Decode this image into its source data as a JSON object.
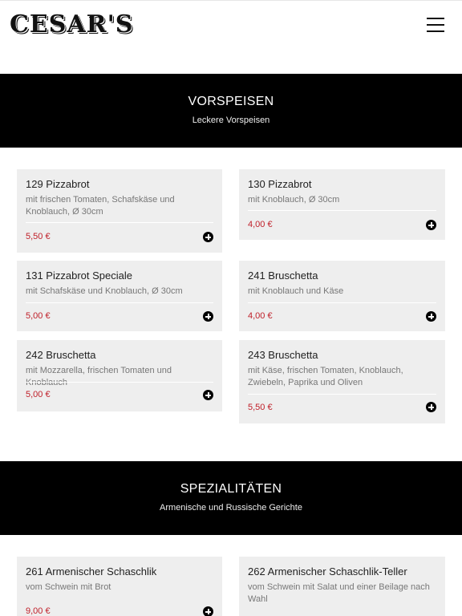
{
  "site": {
    "logo": "CESAR'S"
  },
  "nav": {
    "menu_icon": "hamburger-icon"
  },
  "categories": [
    {
      "title": "VORSPEISEN",
      "subtitle": "Leckere Vorspeisen",
      "items": [
        {
          "name": "129 Pizzabrot",
          "desc": "mit frischen Tomaten, Schafskäse und Knoblauch, Ø 30cm",
          "price": "5,50 €"
        },
        {
          "name": "130 Pizzabrot",
          "desc": "mit Knoblauch, Ø 30cm",
          "price": "4,00 €"
        },
        {
          "name": "131 Pizzabrot Speciale",
          "desc": "mit Schafskäse und Knoblauch, Ø 30cm",
          "price": "5,00 €"
        },
        {
          "name": "241 Bruschetta",
          "desc": "mit Knoblauch und Käse",
          "price": "4,00 €"
        },
        {
          "name": "242 Bruschetta",
          "desc": "mit Mozzarella, frischen Tomaten und Knoblauch",
          "price": "5,00 €"
        },
        {
          "name": "243 Bruschetta",
          "desc": "mit Käse, frischen Tomaten, Knoblauch, Zwiebeln, Paprika und Oliven",
          "price": "5,50 €"
        }
      ]
    },
    {
      "title": "SPEZIALITÄTEN",
      "subtitle": "Armenische und Russische Gerichte",
      "items": [
        {
          "name": "261 Armenischer Schaschlik",
          "desc": "vom Schwein mit Brot",
          "price": "9,00 €"
        },
        {
          "name": "262 Armenischer Schaschlik-Teller",
          "desc": "vom Schwein mit Salat und einer Beilage nach Wahl",
          "price": ""
        }
      ]
    }
  ],
  "colors": {
    "price": "#c0202a",
    "card_bg": "#eeeeee",
    "banner_bg": "#000000"
  },
  "icons": {
    "add": "plus-circle-icon"
  }
}
